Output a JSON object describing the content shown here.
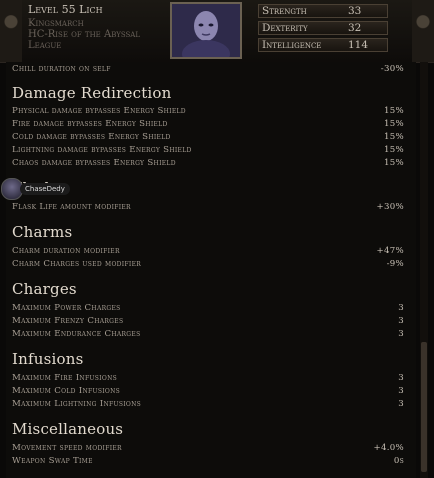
{
  "header": {
    "level_line": "Level 55 Lich",
    "account": "Kingsmarch",
    "league": "HC-Rise of the Abyssal",
    "league_tail": "League"
  },
  "attributes": [
    {
      "label": "Strength",
      "value": "33"
    },
    {
      "label": "Dexterity",
      "value": "32"
    },
    {
      "label": "Intelligence",
      "value": "114"
    }
  ],
  "cut_row": {
    "label": "Chill duration on self",
    "value": "-30%"
  },
  "sections": [
    {
      "title": "Damage Redirection",
      "rows": [
        {
          "label": "Physical damage bypasses Energy Shield",
          "value": "15%"
        },
        {
          "label": "Fire damage bypasses Energy Shield",
          "value": "15%"
        },
        {
          "label": "Cold damage bypasses Energy Shield",
          "value": "15%"
        },
        {
          "label": "Lightning damage bypasses Energy Shield",
          "value": "15%"
        },
        {
          "label": "Chaos damage bypasses Energy Shield",
          "value": "15%"
        }
      ]
    },
    {
      "title": "Flasks",
      "rows": [
        {
          "label": "Flask Life amount modifier",
          "value": "+30%"
        }
      ]
    },
    {
      "title": "Charms",
      "rows": [
        {
          "label": "Charm duration modifier",
          "value": "+47%"
        },
        {
          "label": "Charm Charges used modifier",
          "value": "-9%"
        }
      ]
    },
    {
      "title": "Charges",
      "rows": [
        {
          "label": "Maximum Power Charges",
          "value": "3"
        },
        {
          "label": "Maximum Frenzy Charges",
          "value": "3"
        },
        {
          "label": "Maximum Endurance Charges",
          "value": "3"
        }
      ]
    },
    {
      "title": "Infusions",
      "rows": [
        {
          "label": "Maximum Fire Infusions",
          "value": "3"
        },
        {
          "label": "Maximum Cold Infusions",
          "value": "3"
        },
        {
          "label": "Maximum Lightning Infusions",
          "value": "3"
        }
      ]
    },
    {
      "title": "Miscellaneous",
      "rows": [
        {
          "label": "Movement speed modifier",
          "value": "+4.0%"
        },
        {
          "label": "Weapon Swap Time",
          "value": "0s"
        }
      ]
    }
  ],
  "overlay": {
    "name": "ChaseDedy"
  },
  "colors": {
    "title": "#e2dace",
    "label": "#a89f94",
    "value": "#c8c0b5"
  }
}
